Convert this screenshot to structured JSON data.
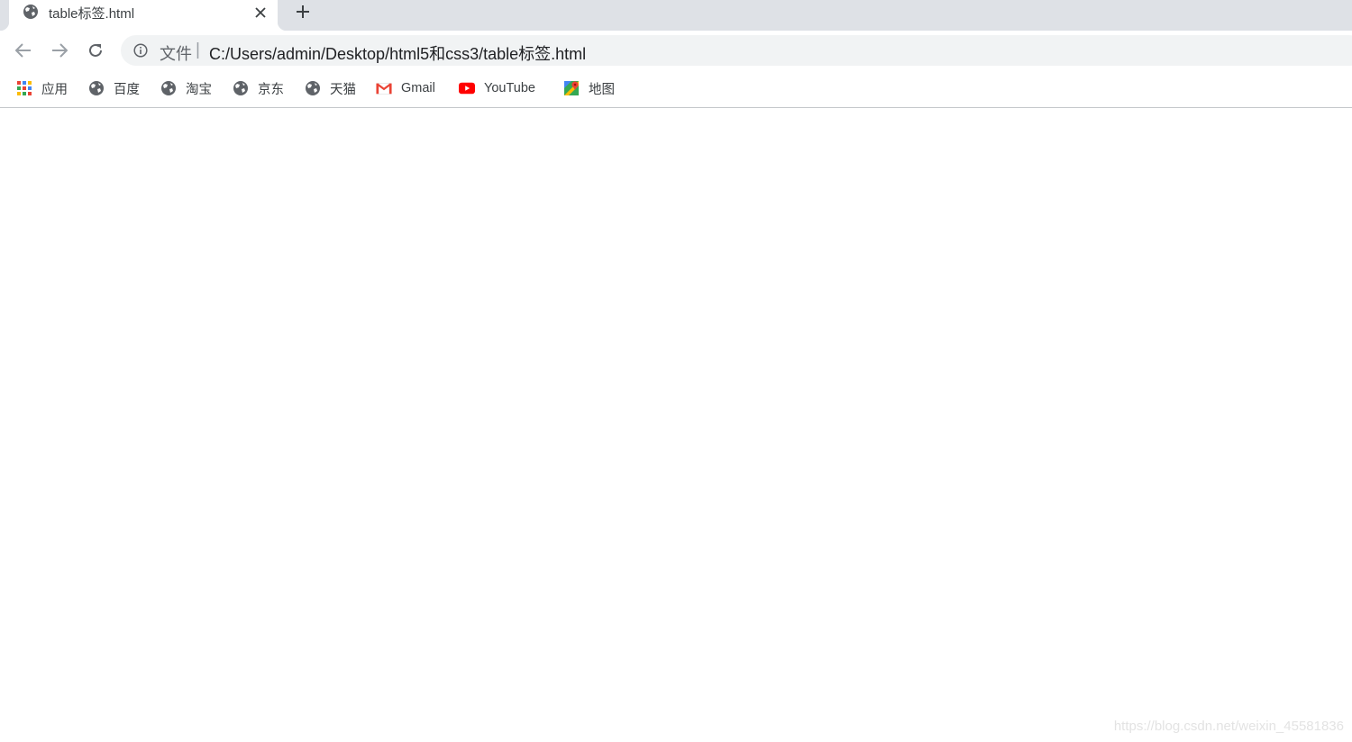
{
  "tab": {
    "title": "table标签.html",
    "favicon": "globe-icon",
    "close_icon": "close-icon",
    "new_tab_icon": "plus-icon"
  },
  "toolbar": {
    "back_icon": "arrow-left-icon",
    "forward_icon": "arrow-right-icon",
    "reload_icon": "reload-icon",
    "omnibox": {
      "info_icon": "info-icon",
      "scheme_label": "文件",
      "separator": "|",
      "url": "C:/Users/admin/Desktop/html5和css3/table标签.html"
    }
  },
  "bookmarks": [
    {
      "label": "应用",
      "icon": "apps-grid-icon"
    },
    {
      "label": "百度",
      "icon": "globe-icon"
    },
    {
      "label": "淘宝",
      "icon": "globe-icon"
    },
    {
      "label": "京东",
      "icon": "globe-icon"
    },
    {
      "label": "天猫",
      "icon": "globe-icon"
    },
    {
      "label": "Gmail",
      "icon": "gmail-icon"
    },
    {
      "label": "YouTube",
      "icon": "youtube-icon"
    },
    {
      "label": "地图",
      "icon": "maps-icon"
    }
  ],
  "watermark": "https://blog.csdn.net/weixin_45581836",
  "colors": {
    "tabstrip_bg": "#dee1e6",
    "omnibox_bg": "#f1f3f4",
    "youtube_red": "#ff0000",
    "gmail_red": "#ea4335"
  }
}
